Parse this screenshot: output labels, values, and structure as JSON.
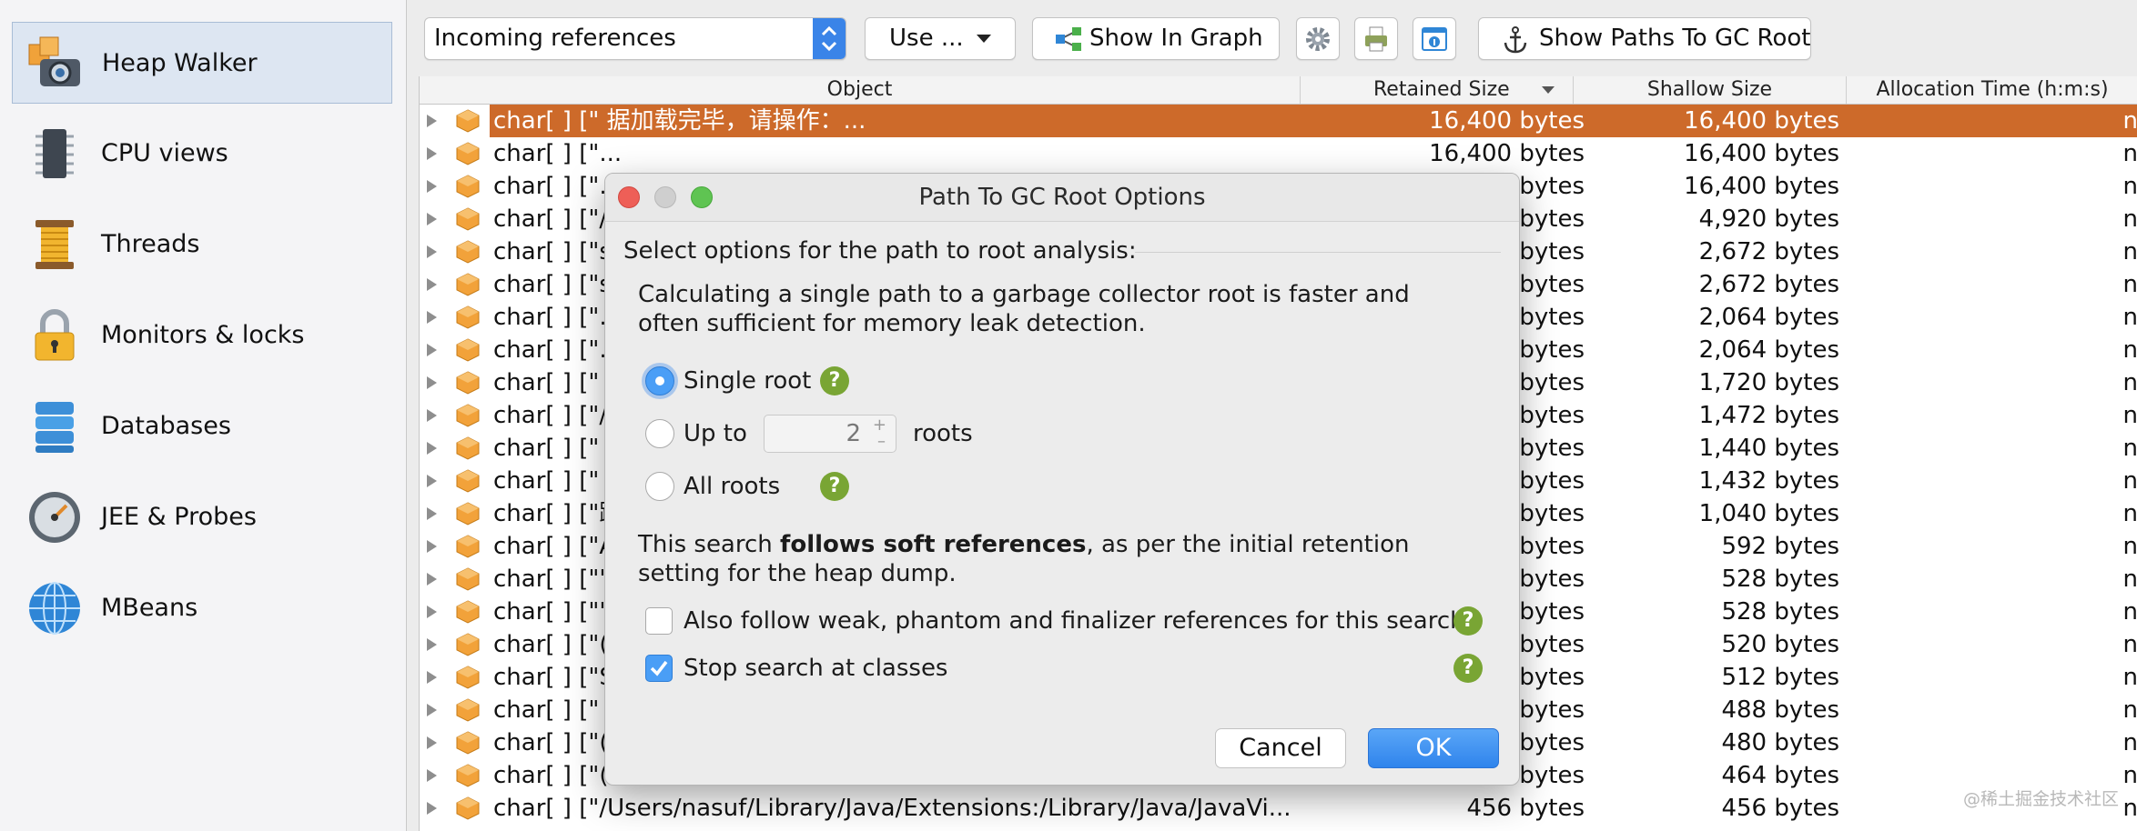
{
  "sidebar": {
    "items": [
      {
        "label": "Heap Walker",
        "icon": "heap-walker-icon",
        "active": true
      },
      {
        "label": "CPU views",
        "icon": "cpu-icon",
        "active": false
      },
      {
        "label": "Threads",
        "icon": "threads-spool-icon",
        "active": false
      },
      {
        "label": "Monitors & locks",
        "icon": "padlock-icon",
        "active": false
      },
      {
        "label": "Databases",
        "icon": "database-icon",
        "active": false
      },
      {
        "label": "JEE & Probes",
        "icon": "gauge-icon",
        "active": false
      },
      {
        "label": "MBeans",
        "icon": "globe-icon",
        "active": false
      }
    ]
  },
  "toolbar": {
    "view_select": "Incoming references",
    "use_label": "Use ...",
    "show_in_graph_label": "Show In Graph",
    "show_paths_label": "Show Paths To GC Root"
  },
  "table": {
    "headers": {
      "object": "Object",
      "retained": "Retained Size",
      "shallow": "Shallow Size",
      "allocation": "Allocation Time (h:m:s)"
    },
    "sort_column": "retained",
    "rows": [
      {
        "object": "char[ ] [\" 据加载完毕，请操作：...",
        "retained": "16,400 bytes",
        "shallow": "16,400 bytes",
        "alloc": "n",
        "selected": true
      },
      {
        "object": "char[ ] [\"...",
        "retained": "16,400 bytes",
        "shallow": "16,400 bytes",
        "alloc": "n"
      },
      {
        "object": "char[ ] [\"...",
        "retained": "bytes",
        "shallow": "16,400 bytes",
        "alloc": "n"
      },
      {
        "object": "char[ ] [\"/L",
        "retained": "bytes",
        "shallow": "4,920 bytes",
        "alloc": "n"
      },
      {
        "object": "char[ ] [\"su",
        "retained": "bytes",
        "shallow": "2,672 bytes",
        "alloc": "n"
      },
      {
        "object": "char[ ] [\"su",
        "retained": "bytes",
        "shallow": "2,672 bytes",
        "alloc": "n"
      },
      {
        "object": "char[ ] [\"...",
        "retained": "bytes",
        "shallow": "2,064 bytes",
        "alloc": "n"
      },
      {
        "object": "char[ ] [\"...",
        "retained": "bytes",
        "shallow": "2,064 bytes",
        "alloc": "n"
      },
      {
        "object": "char[ ] [\" e",
        "retained": "bytes",
        "shallow": "1,720 bytes",
        "alloc": "n"
      },
      {
        "object": "char[ ] [\"/L",
        "retained": "bytes",
        "shallow": "1,472 bytes",
        "alloc": "n"
      },
      {
        "object": "char[ ] [\"  e",
        "retained": "bytes",
        "shallow": "1,440 bytes",
        "alloc": "n"
      },
      {
        "object": "char[ ] [\"  e",
        "retained": "bytes",
        "shallow": "1,432 bytes",
        "alloc": "n"
      },
      {
        "object": "char[ ] [\"踯",
        "retained": "bytes",
        "shallow": "1,040 bytes",
        "alloc": "n"
      },
      {
        "object": "char[ ] [\"Al",
        "retained": "bytes",
        "shallow": "592 bytes",
        "alloc": "n"
      },
      {
        "object": "char[ ] [\"\"]",
        "retained": "bytes",
        "shallow": "528 bytes",
        "alloc": "n"
      },
      {
        "object": "char[ ] [\"\"]",
        "retained": "bytes",
        "shallow": "528 bytes",
        "alloc": "n"
      },
      {
        "object": "char[ ] [\"(L",
        "retained": "bytes",
        "shallow": "520 bytes",
        "alloc": "n"
      },
      {
        "object": "char[ ] [\"SU",
        "retained": "bytes",
        "shallow": "512 bytes",
        "alloc": "n"
      },
      {
        "object": "char[ ] [\"  e",
        "retained": "bytes",
        "shallow": "488 bytes",
        "alloc": "n"
      },
      {
        "object": "char[ ] [\"(L",
        "retained": "bytes",
        "shallow": "480 bytes",
        "alloc": "n"
      },
      {
        "object": "char[ ] [\"(L",
        "retained": "bytes",
        "shallow": "464 bytes",
        "alloc": "n"
      },
      {
        "object": "char[ ] [\"/Users/nasuf/Library/Java/Extensions:/Library/Java/JavaVi...",
        "retained": "456 bytes",
        "shallow": "456 bytes",
        "alloc": "n"
      }
    ]
  },
  "dialog": {
    "title": "Path To GC Root Options",
    "section_label": "Select options for the path to root analysis:",
    "intro": "Calculating a single path to a garbage collector root is faster and often sufficient for memory leak detection.",
    "radio_single": "Single root",
    "radio_upto": "Up to",
    "upto_value": "2",
    "roots_label": "roots",
    "radio_all": "All roots",
    "selected_radio": "single",
    "soft_prefix": "This search ",
    "soft_bold": "follows soft references",
    "soft_suffix": ", as per the initial retention setting for the heap dump.",
    "weak_label": "Also follow weak, phantom and finalizer references for this search",
    "weak_checked": false,
    "stop_label": "Stop search at classes",
    "stop_checked": true,
    "help_glyph": "?",
    "cancel_label": "Cancel",
    "ok_label": "OK"
  },
  "watermark": "@稀土掘金技术社区",
  "colors": {
    "selection": "#cd6a2a",
    "accent_blue": "#3a84e8",
    "help_green": "#79a534",
    "object_orange": "#f2a23a"
  }
}
